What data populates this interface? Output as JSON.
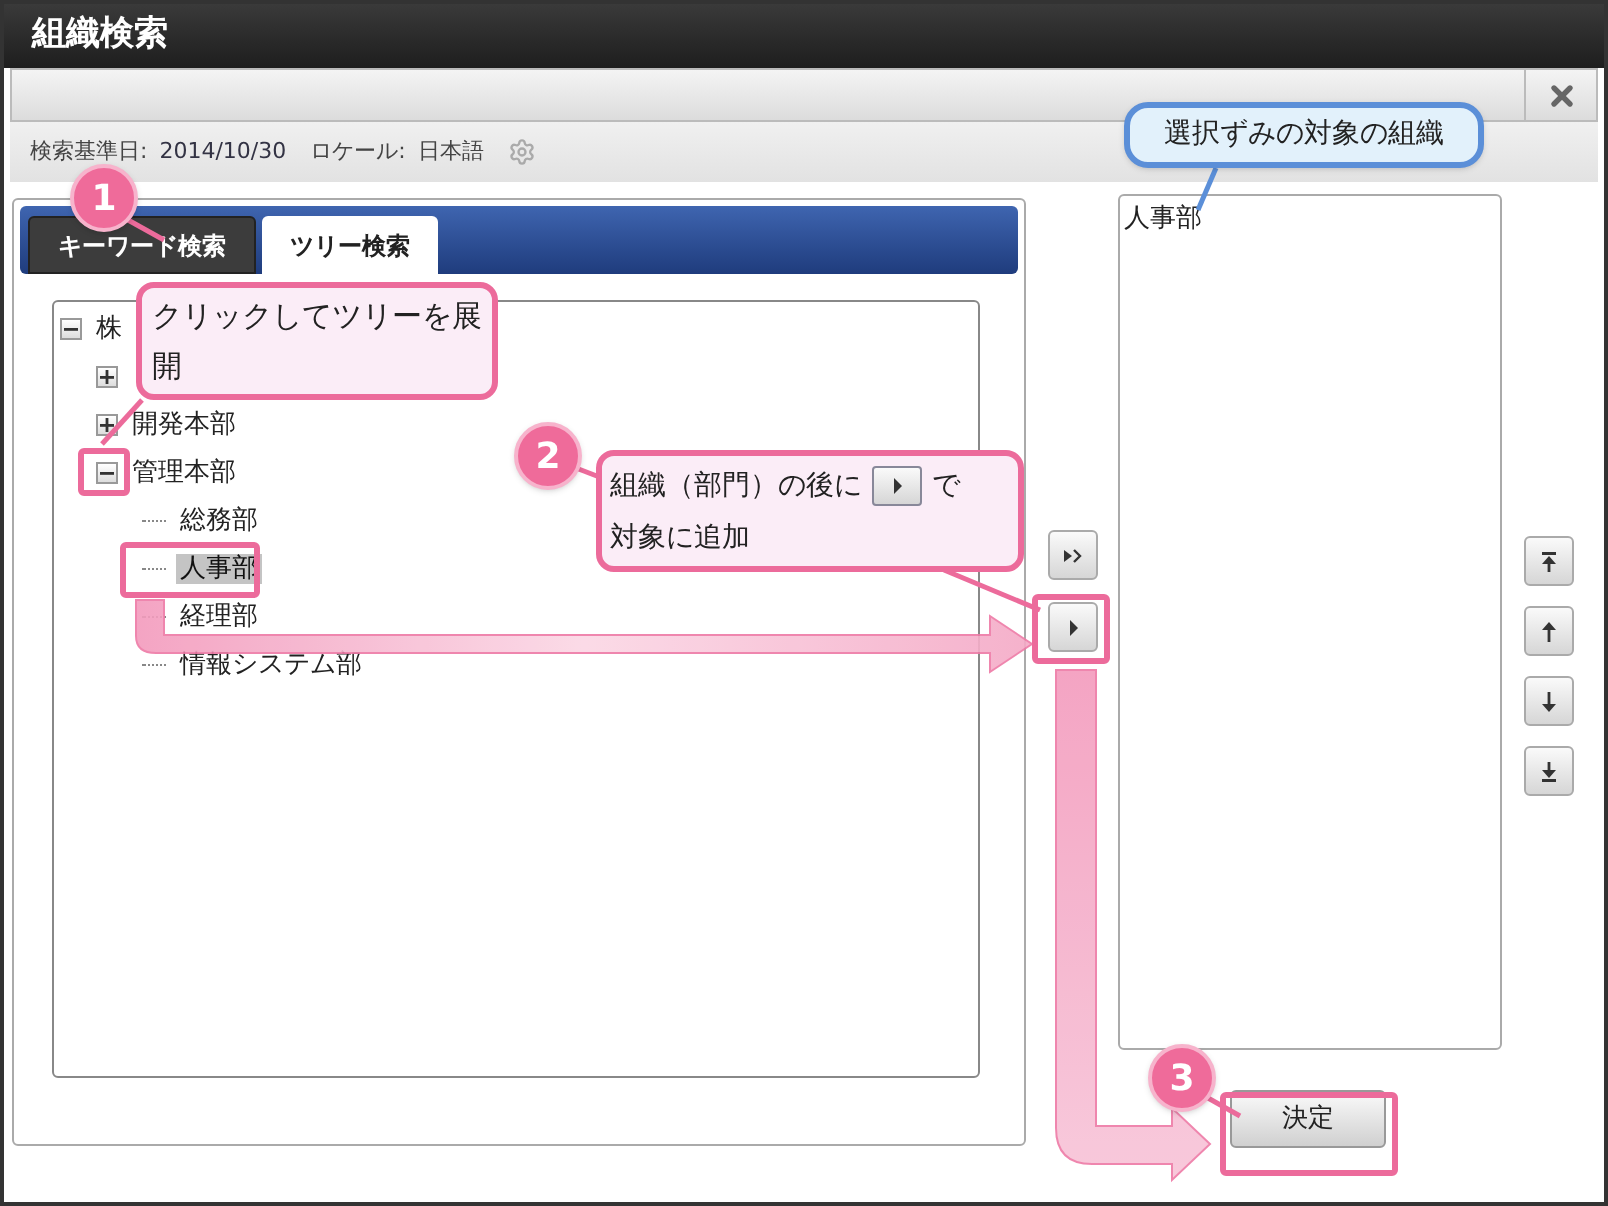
{
  "window": {
    "title": "組織検索"
  },
  "info": {
    "date_label": "検索基準日:",
    "date": "2014/10/30",
    "locale_label": "ロケール:",
    "locale": "日本語"
  },
  "tabs": [
    {
      "label": "キーワード検索",
      "selected": false
    },
    {
      "label": "ツリー検索",
      "selected": true
    }
  ],
  "tree": [
    {
      "label": "株",
      "expanded": true,
      "selected": false,
      "children": [
        {
          "expanded": false
        },
        {
          "label": "開発本部",
          "expanded": false,
          "selected": false
        },
        {
          "label": "管理本部",
          "expanded": true,
          "selected": false,
          "children": [
            {
              "label": "総務部",
              "selected": false
            },
            {
              "label": "人事部",
              "selected": true
            },
            {
              "label": "経理部",
              "selected": false
            },
            {
              "label": "情報システム部",
              "selected": false
            }
          ]
        }
      ]
    }
  ],
  "selected_list": {
    "items": [
      "人事部"
    ]
  },
  "submit_button": "決定",
  "annotations": {
    "steps": [
      "1",
      "2",
      "3"
    ],
    "callout_expand": "クリックしてツリーを展開",
    "callout_add": {
      "before_icon": "組織（部門）の後に",
      "after_icon": "で",
      "second_line": "対象に追加"
    },
    "callout_selected": "選択ずみの対象の組織"
  }
}
